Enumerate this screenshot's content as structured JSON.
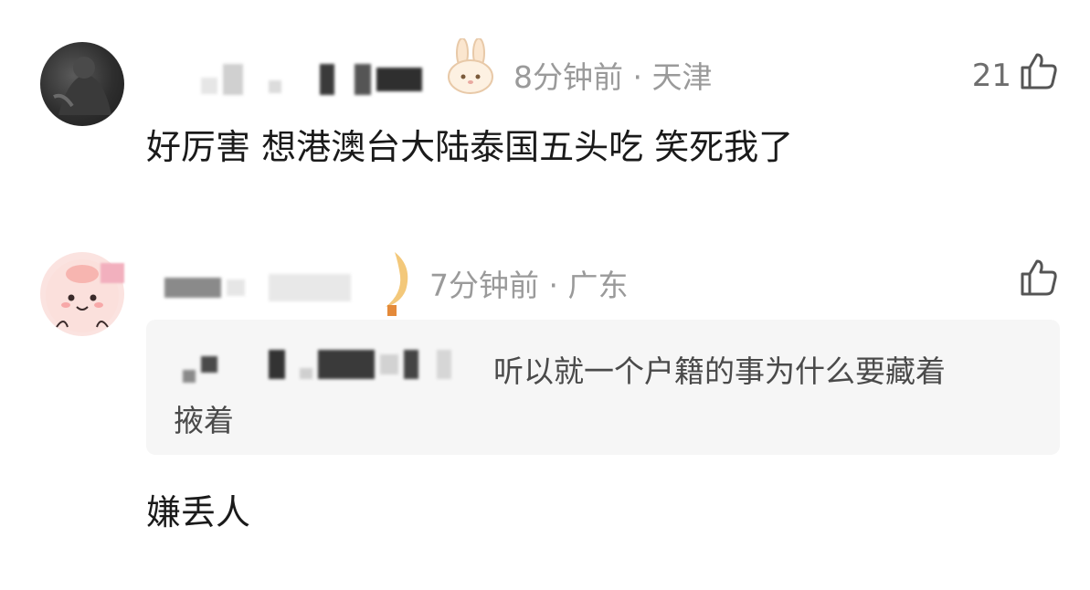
{
  "comments": [
    {
      "time_location": "8分钟前 · 天津",
      "like_count": "21",
      "text": "好厉害 想港澳台大陆泰国五头吃 笑死我了"
    },
    {
      "time_location": "7分钟前 · 广东",
      "like_count": "",
      "quote": {
        "text_line1": "听以就一个户籍的事为什么要藏着",
        "text_line2": "掖着"
      },
      "text": "嫌丢人"
    }
  ],
  "icons": {
    "like": "thumbs-up-icon",
    "badge_1": "bunny-badge-icon",
    "badge_2": "moon-badge-icon"
  }
}
